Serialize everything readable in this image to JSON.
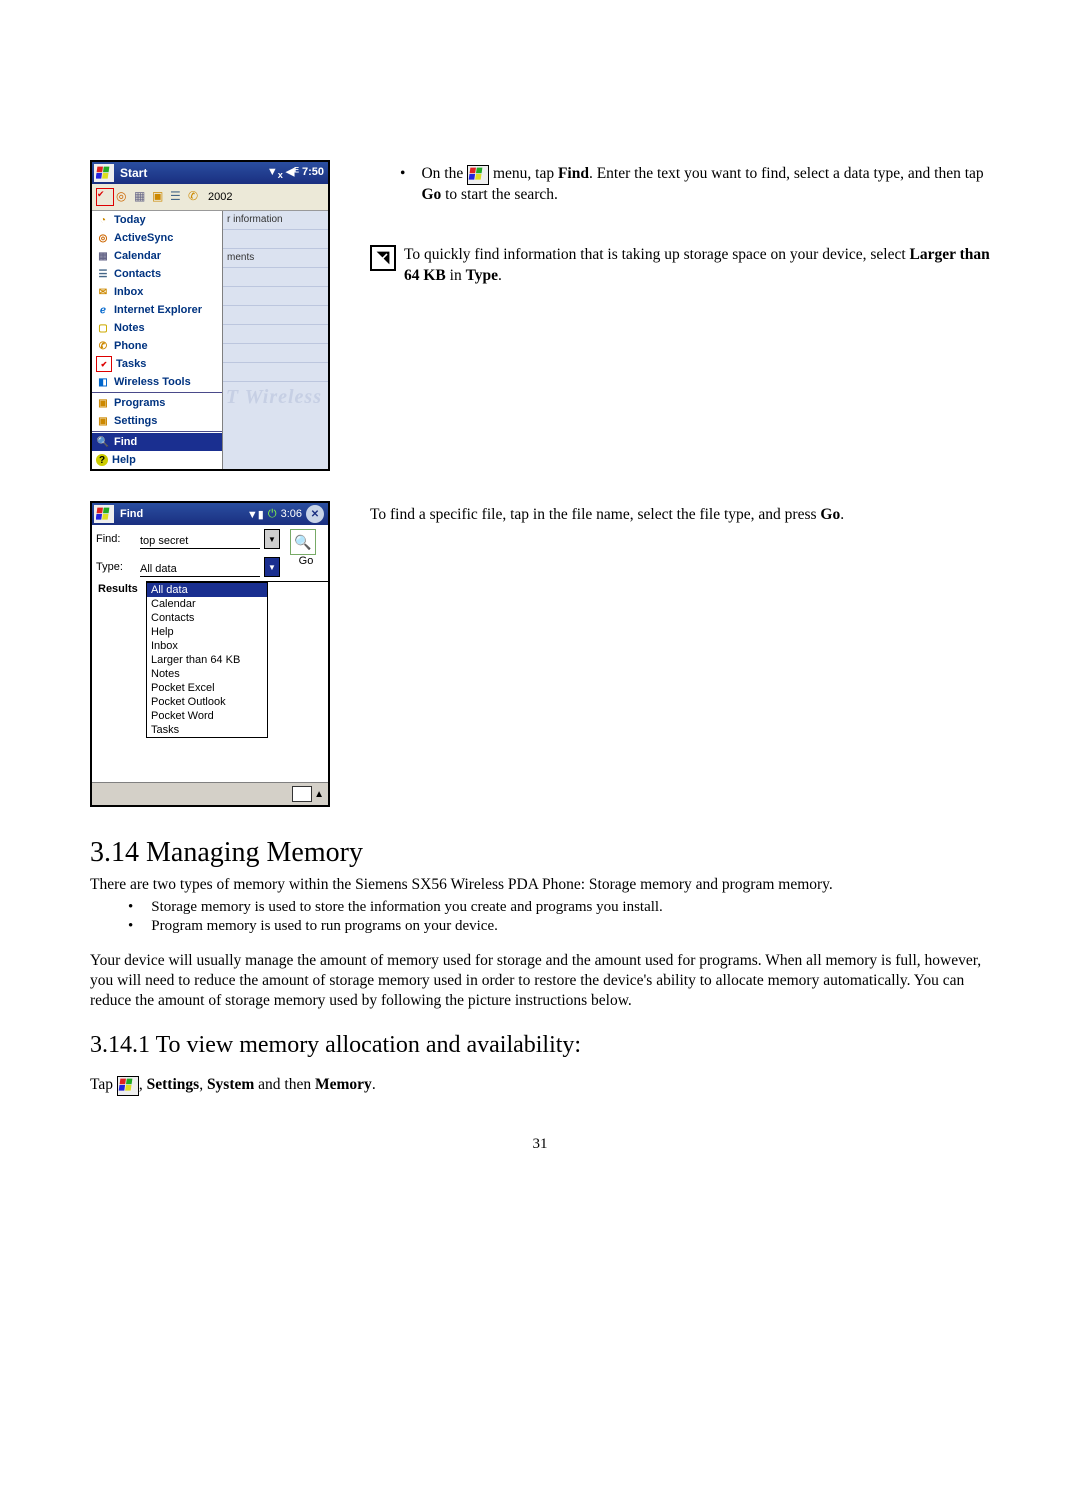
{
  "start_screen": {
    "title": "Start",
    "signal_label": "7:50",
    "toolbar_year": "2002",
    "peek_rows": [
      "r information",
      "",
      "ments",
      "",
      "",
      "",
      "",
      "",
      ""
    ],
    "watermark": "T Wireless",
    "items": [
      {
        "label": "Today",
        "icon": "today-icon"
      },
      {
        "label": "ActiveSync",
        "icon": "sync-icon"
      },
      {
        "label": "Calendar",
        "icon": "calendar-icon"
      },
      {
        "label": "Contacts",
        "icon": "contacts-icon"
      },
      {
        "label": "Inbox",
        "icon": "inbox-icon"
      },
      {
        "label": "Internet Explorer",
        "icon": "ie-icon"
      },
      {
        "label": "Notes",
        "icon": "notes-icon"
      },
      {
        "label": "Phone",
        "icon": "phone-icon"
      },
      {
        "label": "Tasks",
        "icon": "tasks-icon"
      },
      {
        "label": "Wireless Tools",
        "icon": "wireless-icon"
      }
    ],
    "items2": [
      {
        "label": "Programs",
        "icon": "programs-icon"
      },
      {
        "label": "Settings",
        "icon": "settings-icon"
      }
    ],
    "items3": [
      {
        "label": "Find",
        "icon": "find-icon",
        "hl": true
      },
      {
        "label": "Help",
        "icon": "help-icon"
      }
    ]
  },
  "find_screen": {
    "title": "Find",
    "time": "3:06",
    "ok": "✕",
    "find_label": "Find:",
    "find_value": "top secret",
    "type_label": "Type:",
    "type_value": "All data",
    "go_label": "Go",
    "results_label": "Results",
    "options": [
      "All data",
      "Calendar",
      "Contacts",
      "Help",
      "Inbox",
      "Larger than 64 KB",
      "Notes",
      "Pocket Excel",
      "Pocket Outlook",
      "Pocket Word",
      "Tasks"
    ]
  },
  "text": {
    "para1_a": "On the ",
    "para1_b": " menu, tap ",
    "para1_find": "Find",
    "para1_c": ". Enter the text you want to find, select a data type, and then tap ",
    "para1_go": "Go",
    "para1_d": " to start the search.",
    "note1_a": "To quickly find information that is taking up storage space on your device, select ",
    "note1_bold": "Larger than 64 KB",
    "note1_b": " in ",
    "note1_type": "Type",
    "note1_c": ".",
    "para2_a": "To find a specific file, tap in the file name, select the file type, and press ",
    "para2_go": "Go",
    "para2_b": ".",
    "h2": "3.14 Managing Memory",
    "body1": "There are two types of memory within the Siemens SX56 Wireless PDA Phone: Storage memory and program memory.",
    "li1": "Storage memory is used to store the information you create and programs you install.",
    "li2": "Program memory is used to run programs on your device.",
    "body2": "Your device will usually manage the amount of memory used for storage and the amount used for programs.  When all memory is full, however, you will need to reduce the amount of storage memory used in order to restore the device's ability to allocate memory automatically.  You can reduce the amount of storage memory used by following the picture instructions below.",
    "h3": "3.14.1  To view memory allocation and availability:",
    "tap_a": "Tap ",
    "tap_b": ", ",
    "tap_settings": "Settings",
    "tap_c": ", ",
    "tap_system": "System",
    "tap_d": " and then ",
    "tap_memory": "Memory",
    "tap_e": ".",
    "page_num": "31"
  }
}
